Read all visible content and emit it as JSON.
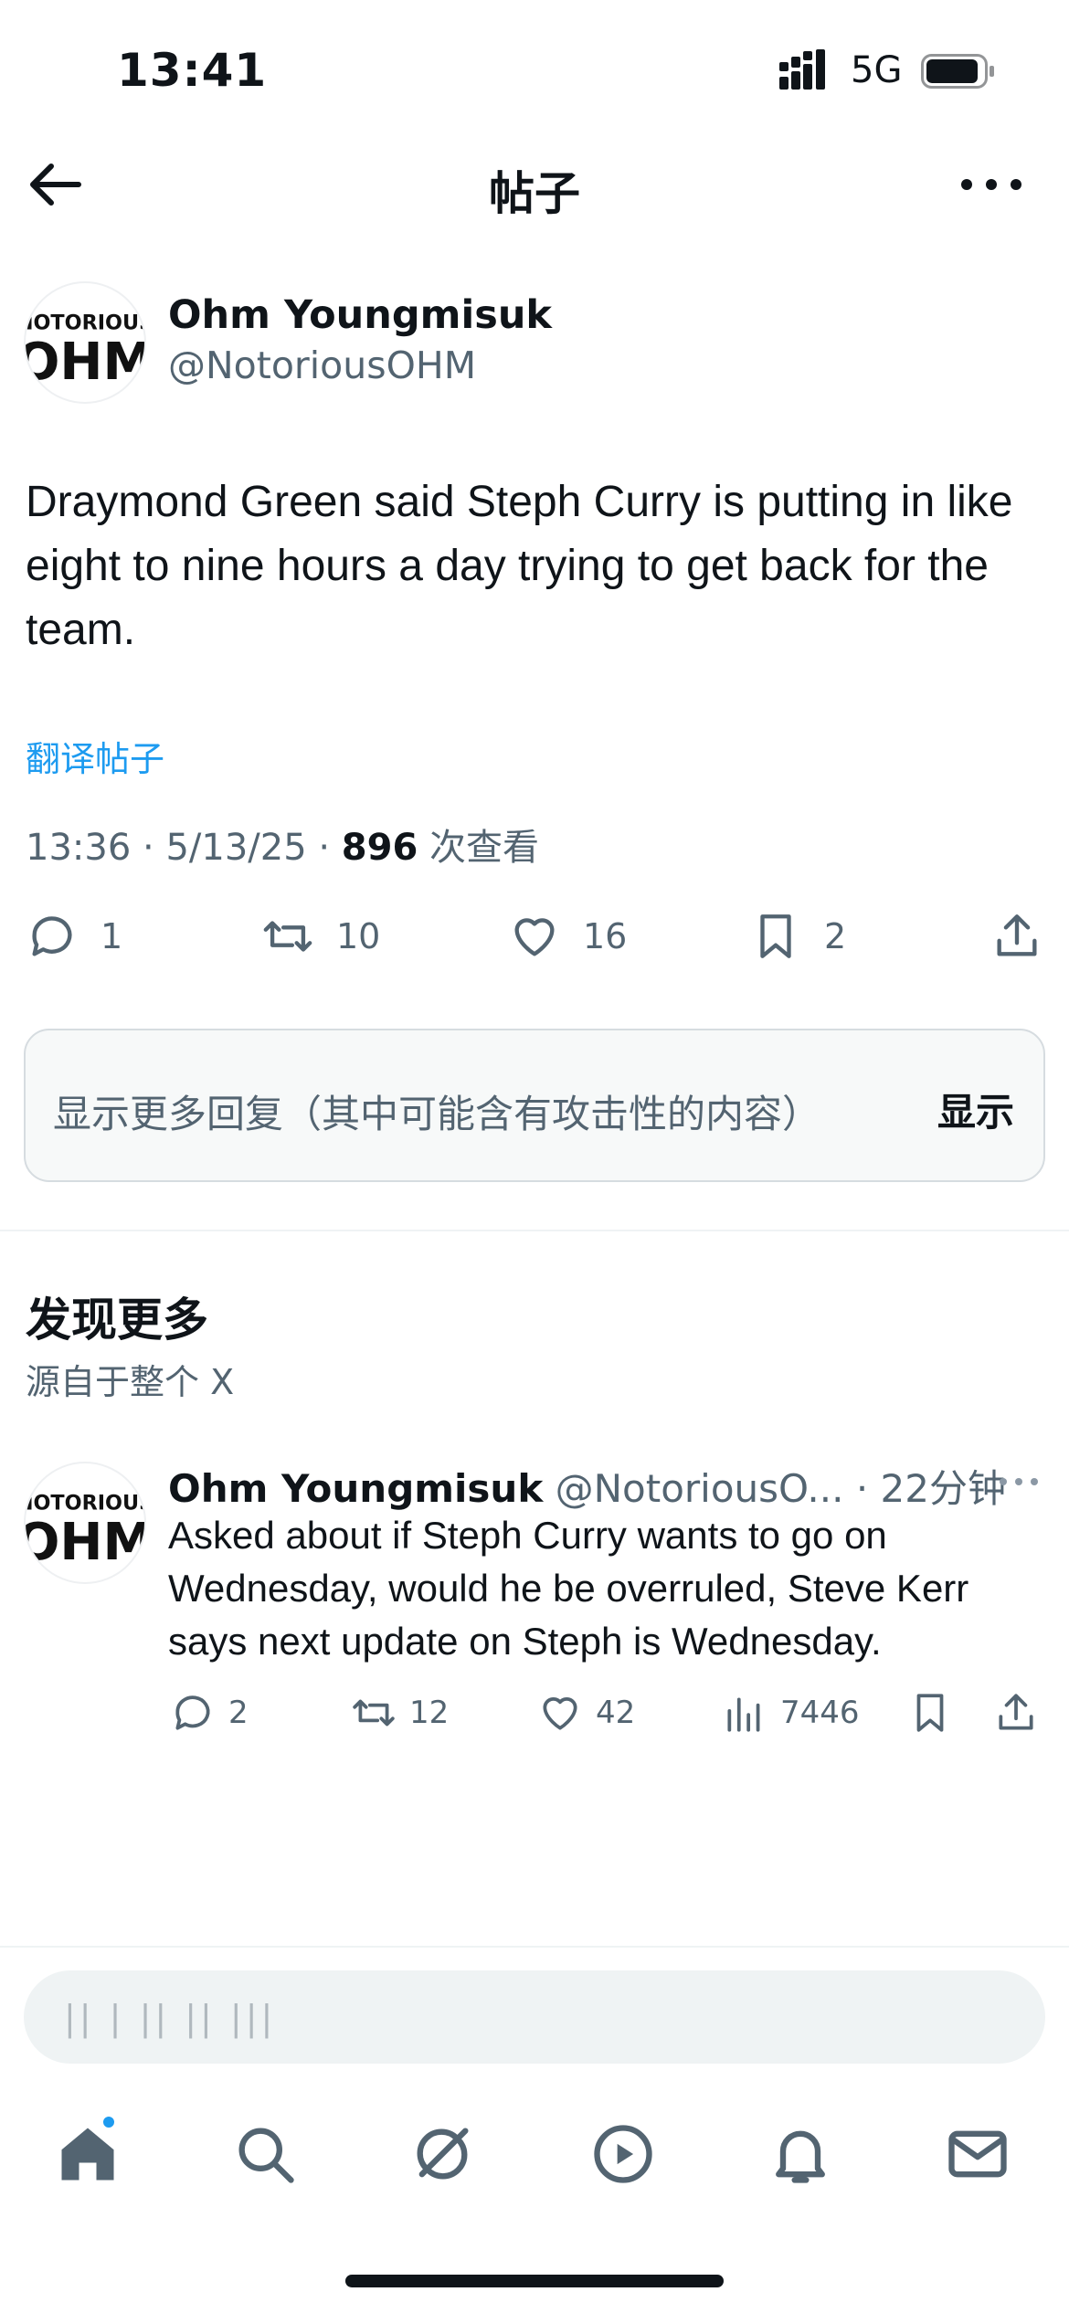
{
  "status_bar": {
    "time": "13:41",
    "network": "5G"
  },
  "nav": {
    "title": "帖子"
  },
  "post": {
    "author_name": "Ohm Youngmisuk",
    "author_handle": "@NotoriousOHM",
    "avatar_text_top": "NOTORIOUS",
    "avatar_text_bottom": "OHM",
    "body": "Draymond Green said Steph Curry is putting in like eight to nine hours a day trying to get back for the team.",
    "translate": "翻译帖子",
    "time": "13:36",
    "date": "5/13/25",
    "views": "896",
    "views_label": "次查看",
    "replies": "1",
    "reposts": "10",
    "likes": "16",
    "bookmarks": "2"
  },
  "more_replies": {
    "text": "显示更多回复（其中可能含有攻击性的内容）",
    "button": "显示"
  },
  "discover": {
    "title": "发现更多",
    "subtitle": "源自于整个 X"
  },
  "recommended": {
    "author_name": "Ohm Youngmisuk",
    "author_handle": "@NotoriousO...",
    "time": "22分钟",
    "body": "Asked about if Steph Curry wants to go on Wednesday, would he be overruled, Steve Kerr says next update on Steph is Wednesday.",
    "replies": "2",
    "reposts": "12",
    "likes": "42",
    "views": "7446"
  },
  "reply_bar": {
    "placeholder": "|| | ||  || |||"
  },
  "tabs": [
    "home",
    "search",
    "grok",
    "video",
    "notifications",
    "messages"
  ],
  "colors": {
    "accent": "#1d9bf0",
    "text": "#0f1419",
    "secondary": "#536471"
  }
}
